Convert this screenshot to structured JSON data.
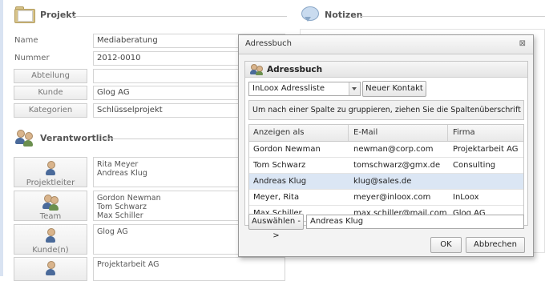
{
  "projekt": {
    "title": "Projekt",
    "fields": [
      {
        "label": "Name",
        "value": "Mediaberatung"
      },
      {
        "label": "Nummer",
        "value": "2012-0010"
      }
    ],
    "buttons": [
      {
        "label": "Abteilung",
        "value": ""
      },
      {
        "label": "Kunde",
        "value": "Glog AG"
      },
      {
        "label": "Kategorien",
        "value": "Schlüsselprojekt"
      }
    ]
  },
  "notizen": {
    "title": "Notizen"
  },
  "verantwortlich": {
    "title": "Verantwortlich",
    "roles": [
      {
        "label": "Projektleiter",
        "value": "Rita Meyer\nAndreas Klug",
        "icon": "person-icon"
      },
      {
        "label": "Team",
        "value": "Gordon Newman\nTom Schwarz\nMax Schiller",
        "icon": "team-icon"
      },
      {
        "label": "Kunde(n)",
        "value": "Glog AG",
        "icon": "person-icon"
      },
      {
        "label": "",
        "value": "Projektarbeit AG",
        "icon": "person-icon"
      }
    ]
  },
  "dialog": {
    "title": "Adressbuch",
    "close": "⊠",
    "panel_title": "Adressbuch",
    "list_select": "InLoox Adressliste",
    "new_contact": "Neuer Kontakt",
    "group_hint": "Um nach einer Spalte zu gruppieren, ziehen Sie die Spaltenüberschrift hierhin.",
    "columns": [
      "Anzeigen als",
      "E-Mail",
      "Firma"
    ],
    "rows": [
      {
        "name": "Gordon Newman",
        "email": "newman@corp.com",
        "firma": "Projektarbeit AG"
      },
      {
        "name": "Tom Schwarz",
        "email": "tomschwarz@gmx.de",
        "firma": "Consulting"
      },
      {
        "name": "Andreas Klug",
        "email": "klug@sales.de",
        "firma": ""
      },
      {
        "name": "Meyer, Rita",
        "email": "meyer@inloox.com",
        "firma": "InLoox"
      },
      {
        "name": "Max Schiller",
        "email": "max.schiller@mail.com",
        "firma": "Glog AG"
      }
    ],
    "selected_row": 2,
    "select_button": "Auswählen ->",
    "selected_value": "Andreas Klug",
    "ok": "OK",
    "cancel": "Abbrechen"
  }
}
